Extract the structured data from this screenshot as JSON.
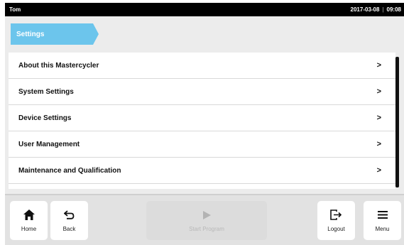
{
  "status_bar": {
    "user": "Tom",
    "date": "2017-03-08",
    "separator": "|",
    "time": "09:08"
  },
  "breadcrumb": {
    "label": "Settings"
  },
  "settings_menu": [
    {
      "label": "About this Mastercycler",
      "chevron": ">"
    },
    {
      "label": "System Settings",
      "chevron": ">"
    },
    {
      "label": "Device Settings",
      "chevron": ">"
    },
    {
      "label": "User Management",
      "chevron": ">"
    },
    {
      "label": "Maintenance and Qualification",
      "chevron": ">"
    }
  ],
  "bottom_bar": {
    "home": {
      "label": "Home",
      "icon": "home-icon"
    },
    "back": {
      "label": "Back",
      "icon": "back-arrow-icon"
    },
    "start_program": {
      "label": "Start Program",
      "icon": "play-icon",
      "enabled": false
    },
    "logout": {
      "label": "Logout",
      "icon": "logout-icon"
    },
    "menu": {
      "label": "Menu",
      "icon": "hamburger-menu-icon"
    }
  },
  "colors": {
    "accent": "#6cc5ec",
    "status_bar": "#000000",
    "background": "#ececec"
  }
}
